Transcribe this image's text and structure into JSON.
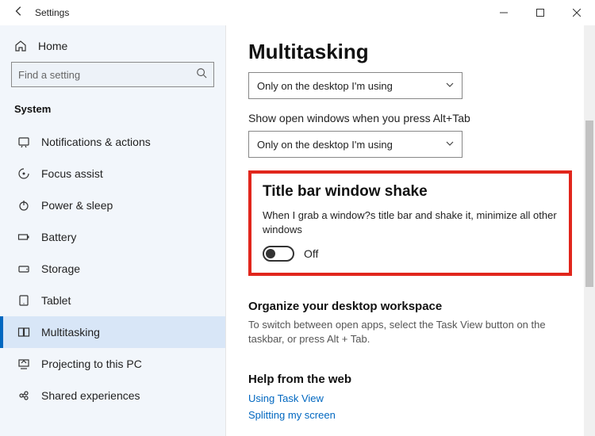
{
  "window": {
    "title": "Settings"
  },
  "sidebar": {
    "home_label": "Home",
    "search_placeholder": "Find a setting",
    "group_label": "System",
    "items": [
      {
        "label": "Notifications & actions",
        "icon": "notifications",
        "active": false
      },
      {
        "label": "Focus assist",
        "icon": "focus",
        "active": false
      },
      {
        "label": "Power & sleep",
        "icon": "power",
        "active": false
      },
      {
        "label": "Battery",
        "icon": "battery",
        "active": false
      },
      {
        "label": "Storage",
        "icon": "storage",
        "active": false
      },
      {
        "label": "Tablet",
        "icon": "tablet",
        "active": false
      },
      {
        "label": "Multitasking",
        "icon": "multitasking",
        "active": true
      },
      {
        "label": "Projecting to this PC",
        "icon": "projecting",
        "active": false
      },
      {
        "label": "Shared experiences",
        "icon": "shared",
        "active": false
      }
    ]
  },
  "main": {
    "title": "Multitasking",
    "dropdown1": {
      "value": "Only on the desktop I'm using"
    },
    "alt_tab_label": "Show open windows when you press Alt+Tab",
    "dropdown2": {
      "value": "Only on the desktop I'm using"
    },
    "shake": {
      "heading": "Title bar window shake",
      "description": "When I grab a window?s title bar and shake it, minimize all other windows",
      "state_text": "Off",
      "state": false
    },
    "workspace": {
      "heading": "Organize your desktop workspace",
      "body": "To switch between open apps, select the Task View button on the taskbar, or press Alt + Tab."
    },
    "help": {
      "heading": "Help from the web",
      "links": [
        "Using Task View",
        "Splitting my screen"
      ]
    }
  },
  "colors": {
    "accent": "#0067c0",
    "highlight": "#e1261c",
    "sidebar_bg": "#f2f6fb"
  }
}
